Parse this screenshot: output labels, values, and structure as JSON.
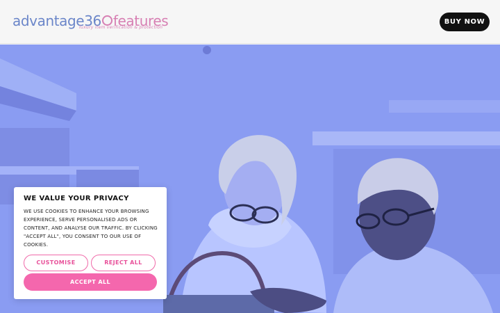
{
  "header": {
    "logo": {
      "part1": "advantage36",
      "part2": "features",
      "tagline": "luxury item verification & protection"
    },
    "buy_now_label": "BUY NOW"
  },
  "cookie_banner": {
    "title": "WE VALUE YOUR PRIVACY",
    "body": "WE USE COOKIES TO ENHANCE YOUR BROWSING EXPERIENCE, SERVE PERSONALISED ADS OR CONTENT, AND ANALYSE OUR TRAFFIC. BY CLICKING \"ACCEPT ALL\", YOU CONSENT TO OUR USE OF COOKIES.",
    "customise_label": "CUSTOMISE",
    "reject_label": "REJECT ALL",
    "accept_label": "ACCEPT ALL"
  },
  "colors": {
    "accent_pink": "#f467ad",
    "logo_blue": "#6b86c9",
    "hero_overlay": "#8597ef",
    "button_dark": "#111111"
  }
}
